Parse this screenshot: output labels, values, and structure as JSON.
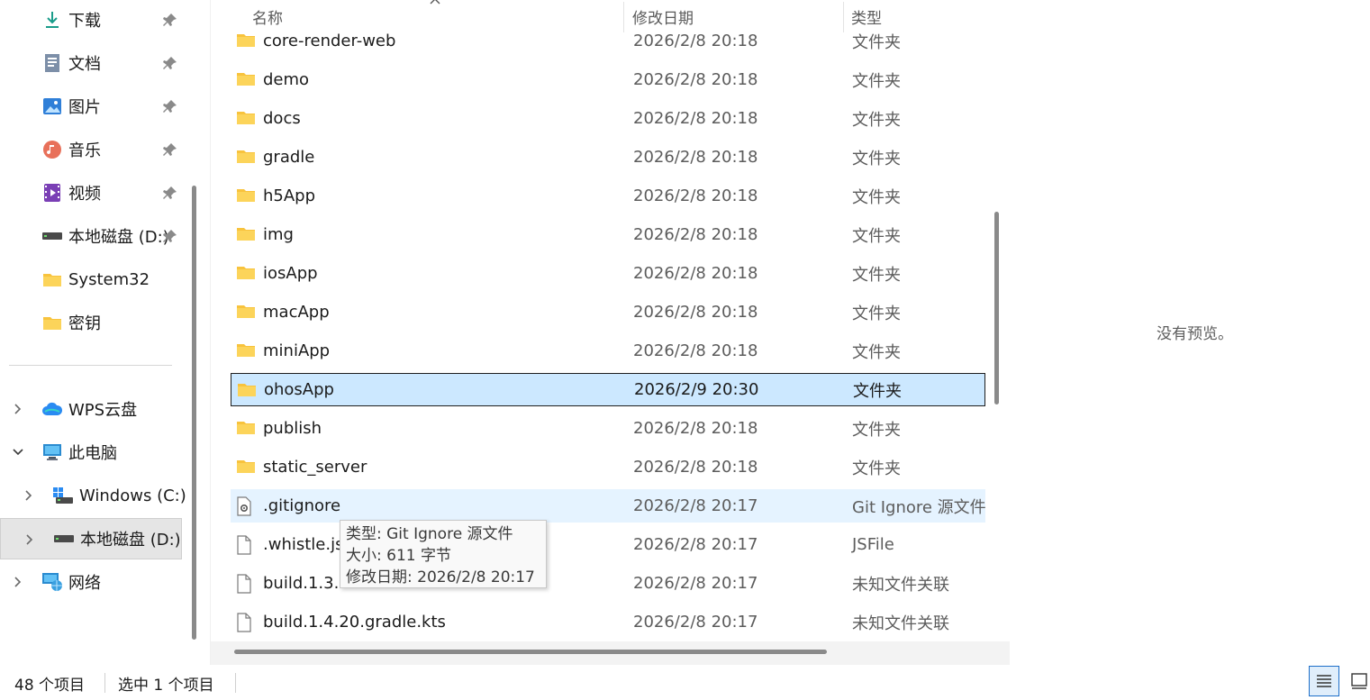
{
  "sidebar": {
    "quick_access": [
      {
        "label": "下载",
        "icon": "download-icon"
      },
      {
        "label": "文档",
        "icon": "document-icon"
      },
      {
        "label": "图片",
        "icon": "pictures-icon"
      },
      {
        "label": "音乐",
        "icon": "music-icon"
      },
      {
        "label": "视频",
        "icon": "video-icon"
      },
      {
        "label": "本地磁盘 (D:)",
        "icon": "drive-icon"
      },
      {
        "label": "System32",
        "icon": "folder-icon"
      },
      {
        "label": "密钥",
        "icon": "folder-icon"
      }
    ],
    "tree": [
      {
        "label": "WPS云盘",
        "icon": "cloud-icon"
      },
      {
        "label": "此电脑",
        "icon": "computer-icon"
      },
      {
        "label": "Windows (C:)",
        "icon": "windows-drive-icon"
      },
      {
        "label": "本地磁盘 (D:)",
        "icon": "drive-icon"
      },
      {
        "label": "网络",
        "icon": "network-icon"
      }
    ]
  },
  "columns": {
    "name": "名称",
    "date": "修改日期",
    "type": "类型"
  },
  "files": [
    {
      "name": "core-render-web",
      "date": "2026/2/8 20:18",
      "type": "文件夹",
      "kind": "folder"
    },
    {
      "name": "demo",
      "date": "2026/2/8 20:18",
      "type": "文件夹",
      "kind": "folder"
    },
    {
      "name": "docs",
      "date": "2026/2/8 20:18",
      "type": "文件夹",
      "kind": "folder"
    },
    {
      "name": "gradle",
      "date": "2026/2/8 20:18",
      "type": "文件夹",
      "kind": "folder"
    },
    {
      "name": "h5App",
      "date": "2026/2/8 20:18",
      "type": "文件夹",
      "kind": "folder"
    },
    {
      "name": "img",
      "date": "2026/2/8 20:18",
      "type": "文件夹",
      "kind": "folder"
    },
    {
      "name": "iosApp",
      "date": "2026/2/8 20:18",
      "type": "文件夹",
      "kind": "folder"
    },
    {
      "name": "macApp",
      "date": "2026/2/8 20:18",
      "type": "文件夹",
      "kind": "folder"
    },
    {
      "name": "miniApp",
      "date": "2026/2/8 20:18",
      "type": "文件夹",
      "kind": "folder"
    },
    {
      "name": "ohosApp",
      "date": "2026/2/9 20:30",
      "type": "文件夹",
      "kind": "folder"
    },
    {
      "name": "publish",
      "date": "2026/2/8 20:18",
      "type": "文件夹",
      "kind": "folder"
    },
    {
      "name": "static_server",
      "date": "2026/2/8 20:18",
      "type": "文件夹",
      "kind": "folder"
    },
    {
      "name": ".gitignore",
      "date": "2026/2/8 20:17",
      "type": "Git Ignore 源文件",
      "kind": "gear"
    },
    {
      "name": ".whistle.js",
      "date": "2026/2/8 20:17",
      "type": "JSFile",
      "kind": "file"
    },
    {
      "name": "build.1.3.1",
      "date": "2026/2/8 20:17",
      "type": "未知文件关联",
      "kind": "file"
    },
    {
      "name": "build.1.4.20.gradle.kts",
      "date": "2026/2/8 20:17",
      "type": "未知文件关联",
      "kind": "file"
    }
  ],
  "tooltip": {
    "line1": "类型: Git Ignore 源文件",
    "line2": "大小: 611 字节",
    "line3": "修改日期: 2026/2/8 20:17"
  },
  "preview": {
    "message": "没有预览。"
  },
  "status": {
    "item_count": "48 个项目",
    "selected": "选中 1 个项目"
  },
  "colors": {
    "selection": "#cce8ff",
    "hover": "#e5f3ff",
    "folder": "#f8c33d",
    "accent": "#1e6fc9"
  }
}
